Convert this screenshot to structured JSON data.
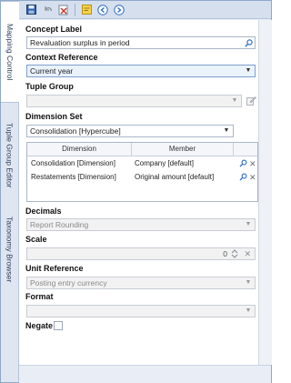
{
  "vertical_tabs": [
    {
      "label": "Mapping Control",
      "active": true
    },
    {
      "label": "Tuple Group Editor",
      "active": false
    },
    {
      "label": "Taxonomy Browser",
      "active": false
    }
  ],
  "toolbar": {
    "icons": [
      "save-icon",
      "undo-icon",
      "delete-icon",
      "note-icon",
      "back-icon",
      "forward-icon"
    ]
  },
  "concept_label": {
    "label": "Concept Label",
    "value": "Revaluation surplus in period"
  },
  "context_reference": {
    "label": "Context Reference",
    "value": "Current year"
  },
  "tuple_group": {
    "label": "Tuple Group",
    "value": ""
  },
  "dimension_set": {
    "label": "Dimension Set",
    "value": "Consolidation [Hypercube]",
    "columns": [
      "Dimension",
      "Member"
    ],
    "rows": [
      {
        "dimension": "Consolidation [Dimension]",
        "member": "Company [default]"
      },
      {
        "dimension": "Restatements [Dimension]",
        "member": "Original amount [default]"
      }
    ]
  },
  "decimals": {
    "label": "Decimals",
    "value": "Report Rounding"
  },
  "scale": {
    "label": "Scale",
    "value": "0"
  },
  "unit_reference": {
    "label": "Unit Reference",
    "value": "Posting entry currency"
  },
  "format": {
    "label": "Format",
    "value": ""
  },
  "negate": {
    "label": "Negate",
    "checked": false
  },
  "colors": {
    "accent": "#2f6fc4",
    "selected_bg": "#eaf2fc",
    "tab_bg": "#dfe6f1"
  }
}
